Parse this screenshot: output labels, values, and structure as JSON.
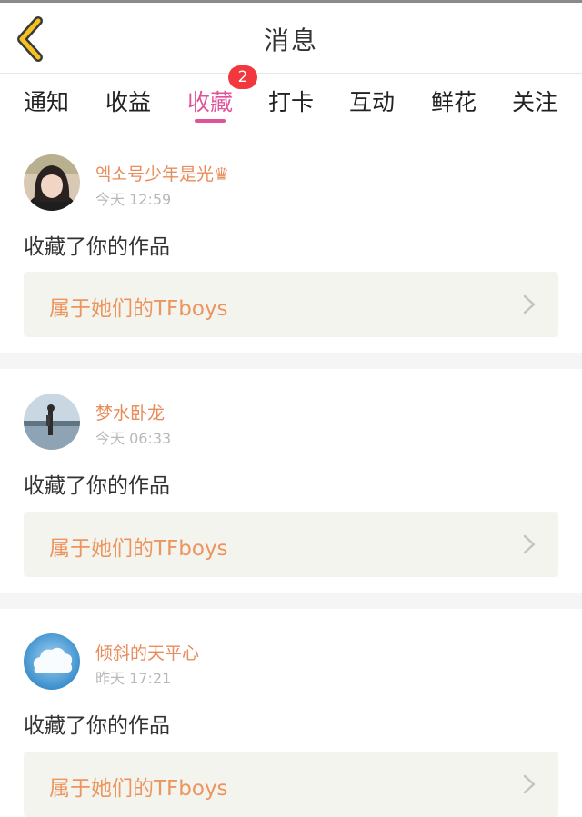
{
  "header": {
    "title": "消息",
    "back_icon": "chevron-left-icon"
  },
  "tabs": [
    {
      "label": "通知"
    },
    {
      "label": "收益"
    },
    {
      "label": "收藏",
      "active": true,
      "badge": "2"
    },
    {
      "label": "打卡"
    },
    {
      "label": "互动"
    },
    {
      "label": "鲜花"
    },
    {
      "label": "关注"
    }
  ],
  "colors": {
    "accent": "#e0529a",
    "badge": "#f2373e",
    "name": "#e88c5c",
    "work": "#ec955f"
  },
  "messages": [
    {
      "username": "엑소号少年是光♛",
      "time": "今天 12:59",
      "action": "收藏了你的作品",
      "work_title": "属于她们的TFboys"
    },
    {
      "username": "梦水卧龙",
      "time": "今天 06:33",
      "action": "收藏了你的作品",
      "work_title": "属于她们的TFboys"
    },
    {
      "username": "倾斜的天平心",
      "time": "昨天 17:21",
      "action": "收藏了你的作品",
      "work_title": "属于她们的TFboys"
    }
  ]
}
